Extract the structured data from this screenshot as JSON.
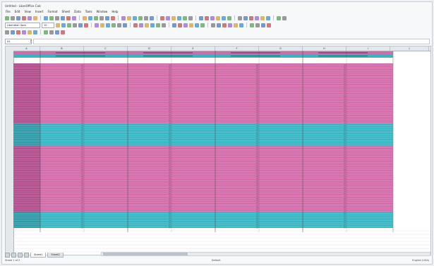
{
  "window": {
    "title": "Untitled - LibreOffice Calc"
  },
  "menu": [
    "File",
    "Edit",
    "View",
    "Insert",
    "Format",
    "Sheet",
    "Data",
    "Tools",
    "Window",
    "Help"
  ],
  "toolbar": {
    "font_name": "Liberation Sans",
    "font_size": "10"
  },
  "namebox": {
    "value": "A1"
  },
  "columns": [
    "A",
    "B",
    "C",
    "D",
    "E",
    "F",
    "G",
    "H",
    "I",
    "J"
  ],
  "sheet_tabs": [
    "Sheet1",
    "Sheet2"
  ],
  "status": {
    "left": "Sheet 1 of 2",
    "middle": "Default",
    "right": "English (USA)"
  },
  "colors": {
    "magenta": "#d36aa9",
    "cyan": "#35b6c4",
    "dark_header": "#8a2e66"
  }
}
